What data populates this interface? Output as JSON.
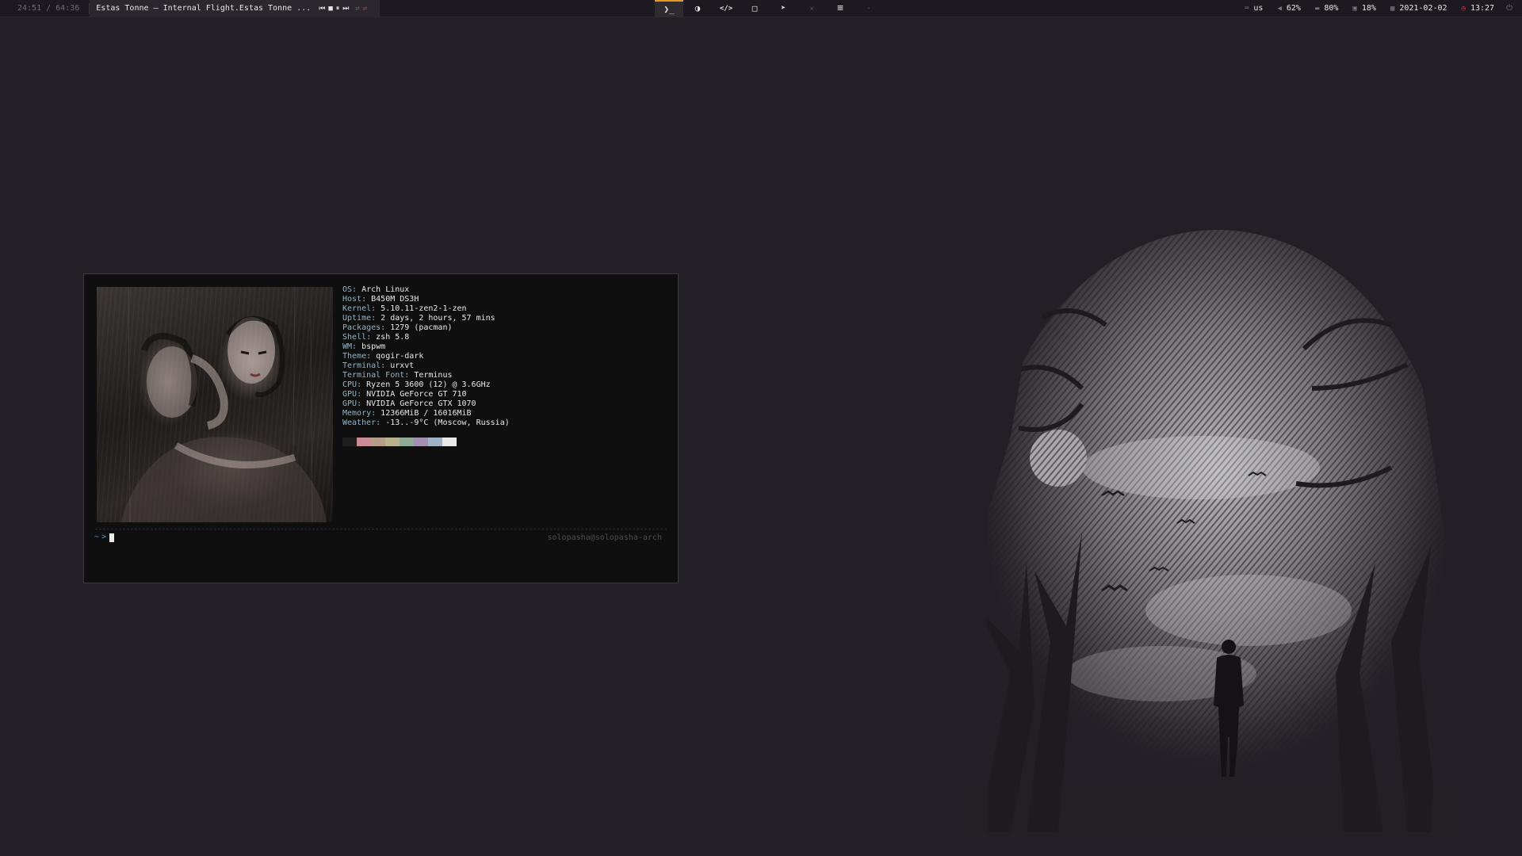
{
  "bar": {
    "player": {
      "time": "24:51 / 64:36",
      "title": "Estas Tonne – Internal Flight.Estas Tonne ...",
      "controls": [
        "⏮",
        "■",
        "⏸",
        "⏭"
      ],
      "repeat_icon": "⇄",
      "shuffle_icon": "⇌"
    },
    "workspaces": [
      {
        "icon": "terminal-icon",
        "glyph": "❯_",
        "active": true
      },
      {
        "icon": "browser-icon",
        "glyph": "◑",
        "active": false
      },
      {
        "icon": "code-icon",
        "glyph": "</>",
        "active": false
      },
      {
        "icon": "folder-icon",
        "glyph": "□",
        "active": false
      },
      {
        "icon": "telegram-icon",
        "glyph": "➤",
        "active": false
      },
      {
        "icon": "empty-icon",
        "glyph": "×",
        "active": false
      },
      {
        "icon": "menu-icon",
        "glyph": "≡",
        "active": false
      },
      {
        "icon": "extra-icon",
        "glyph": "·",
        "active": false
      }
    ],
    "keyboard": "us",
    "volume": "62%",
    "memory": "80%",
    "cpu": "18%",
    "date": "2021-02-02",
    "time": "13:27"
  },
  "terminal": {
    "info": [
      {
        "key": "OS",
        "value": "Arch Linux"
      },
      {
        "key": "Host",
        "value": "B450M DS3H"
      },
      {
        "key": "Kernel",
        "value": "5.10.11-zen2-1-zen"
      },
      {
        "key": "Uptime",
        "value": "2 days, 2 hours, 57 mins"
      },
      {
        "key": "Packages",
        "value": "1279 (pacman)"
      },
      {
        "key": "Shell",
        "value": "zsh 5.8"
      },
      {
        "key": "WM",
        "value": "bspwm"
      },
      {
        "key": "Theme",
        "value": "qogir-dark"
      },
      {
        "key": "Terminal",
        "value": "urxvt"
      },
      {
        "key": "Terminal Font",
        "value": "Terminus"
      },
      {
        "key": "CPU",
        "value": "Ryzen 5 3600 (12) @ 3.6GHz"
      },
      {
        "key": "GPU",
        "value": "NVIDIA GeForce GT 710"
      },
      {
        "key": "GPU",
        "value": "NVIDIA GeForce GTX 1070"
      },
      {
        "key": "Memory",
        "value": "12366MiB / 16016MiB"
      },
      {
        "key": "Weather",
        "value": "-13..-9°C (Moscow, Russia)"
      }
    ],
    "palette": [
      "#1e1e1e",
      "#c98c95",
      "#b79c8a",
      "#b9b28f",
      "#8eaa96",
      "#a18fb4",
      "#9fb3c4",
      "#e8e8e8"
    ],
    "prompt_tilde": "~",
    "prompt_arrow": ">",
    "userhost": "solopasha@solopasha-arch"
  }
}
